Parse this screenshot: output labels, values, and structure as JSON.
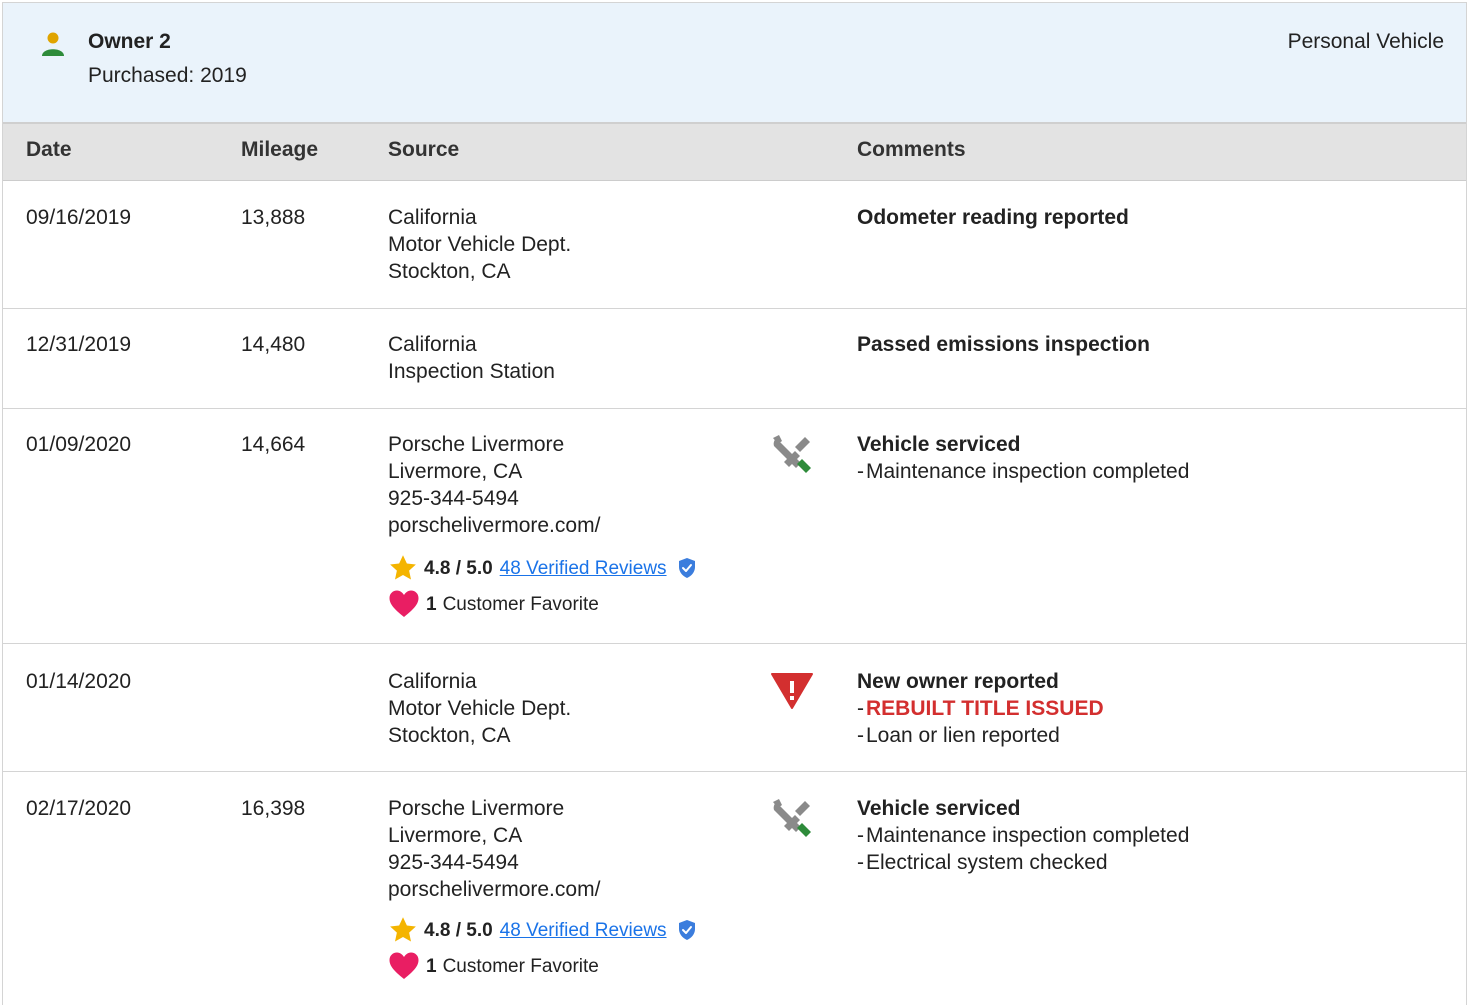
{
  "owner": {
    "name": "Owner 2",
    "purchased": "Purchased: 2019",
    "type": "Personal Vehicle",
    "icon": "person-icon",
    "icon_colors": {
      "head": "#e0a400",
      "body": "#2e8b3a"
    }
  },
  "columns": {
    "date": "Date",
    "mileage": "Mileage",
    "source": "Source",
    "comments": "Comments"
  },
  "records": [
    {
      "date": "09/16/2019",
      "mileage": "13,888",
      "source": [
        "California",
        "Motor Vehicle Dept.",
        "Stockton, CA"
      ],
      "comments": {
        "title": "Odometer reading reported",
        "details": []
      }
    },
    {
      "date": "12/31/2019",
      "mileage": "14,480",
      "source": [
        "California",
        "Inspection Station"
      ],
      "comments": {
        "title": "Passed emissions inspection",
        "details": []
      }
    },
    {
      "date": "01/09/2020",
      "mileage": "14,664",
      "source": [
        "Porsche Livermore",
        "Livermore, CA",
        "925-344-5494",
        "porschelivermore.com/"
      ],
      "rating": {
        "score": "4.8 / 5.0",
        "reviews": "48 Verified Reviews"
      },
      "favorite": {
        "count": "1",
        "label": "Customer Favorite"
      },
      "icon": "service-tools-icon",
      "comments": {
        "title": "Vehicle serviced",
        "dash": "-",
        "details": [
          "Maintenance inspection completed"
        ]
      }
    },
    {
      "date": "01/14/2020",
      "mileage": "",
      "source": [
        "California",
        "Motor Vehicle Dept.",
        "Stockton, CA"
      ],
      "icon": "warning-triangle-icon",
      "comments": {
        "title": "New owner reported",
        "dash": "-",
        "alert": "REBUILT TITLE ISSUED",
        "details": [
          "Loan or lien reported"
        ]
      }
    },
    {
      "date": "02/17/2020",
      "mileage": "16,398",
      "source": [
        "Porsche Livermore",
        "Livermore, CA",
        "925-344-5494",
        "porschelivermore.com/"
      ],
      "rating": {
        "score": "4.8 / 5.0",
        "reviews": "48 Verified Reviews"
      },
      "favorite": {
        "count": "1",
        "label": "Customer Favorite"
      },
      "icon": "service-tools-icon",
      "comments": {
        "title": "Vehicle serviced",
        "dash": "-",
        "details": [
          "Maintenance inspection completed",
          "Electrical system checked"
        ]
      }
    }
  ],
  "colors": {
    "header_bg": "#eaf3fb",
    "column_header_bg": "#e3e3e3",
    "alert": "#d32f2f",
    "link": "#1a73e8",
    "star": "#f4b400",
    "heart": "#e91e63",
    "badge": "#3b7ddd",
    "tool_gray": "#8a8a8a",
    "tool_green": "#2e8b3a",
    "warning_red": "#d32f2f"
  }
}
